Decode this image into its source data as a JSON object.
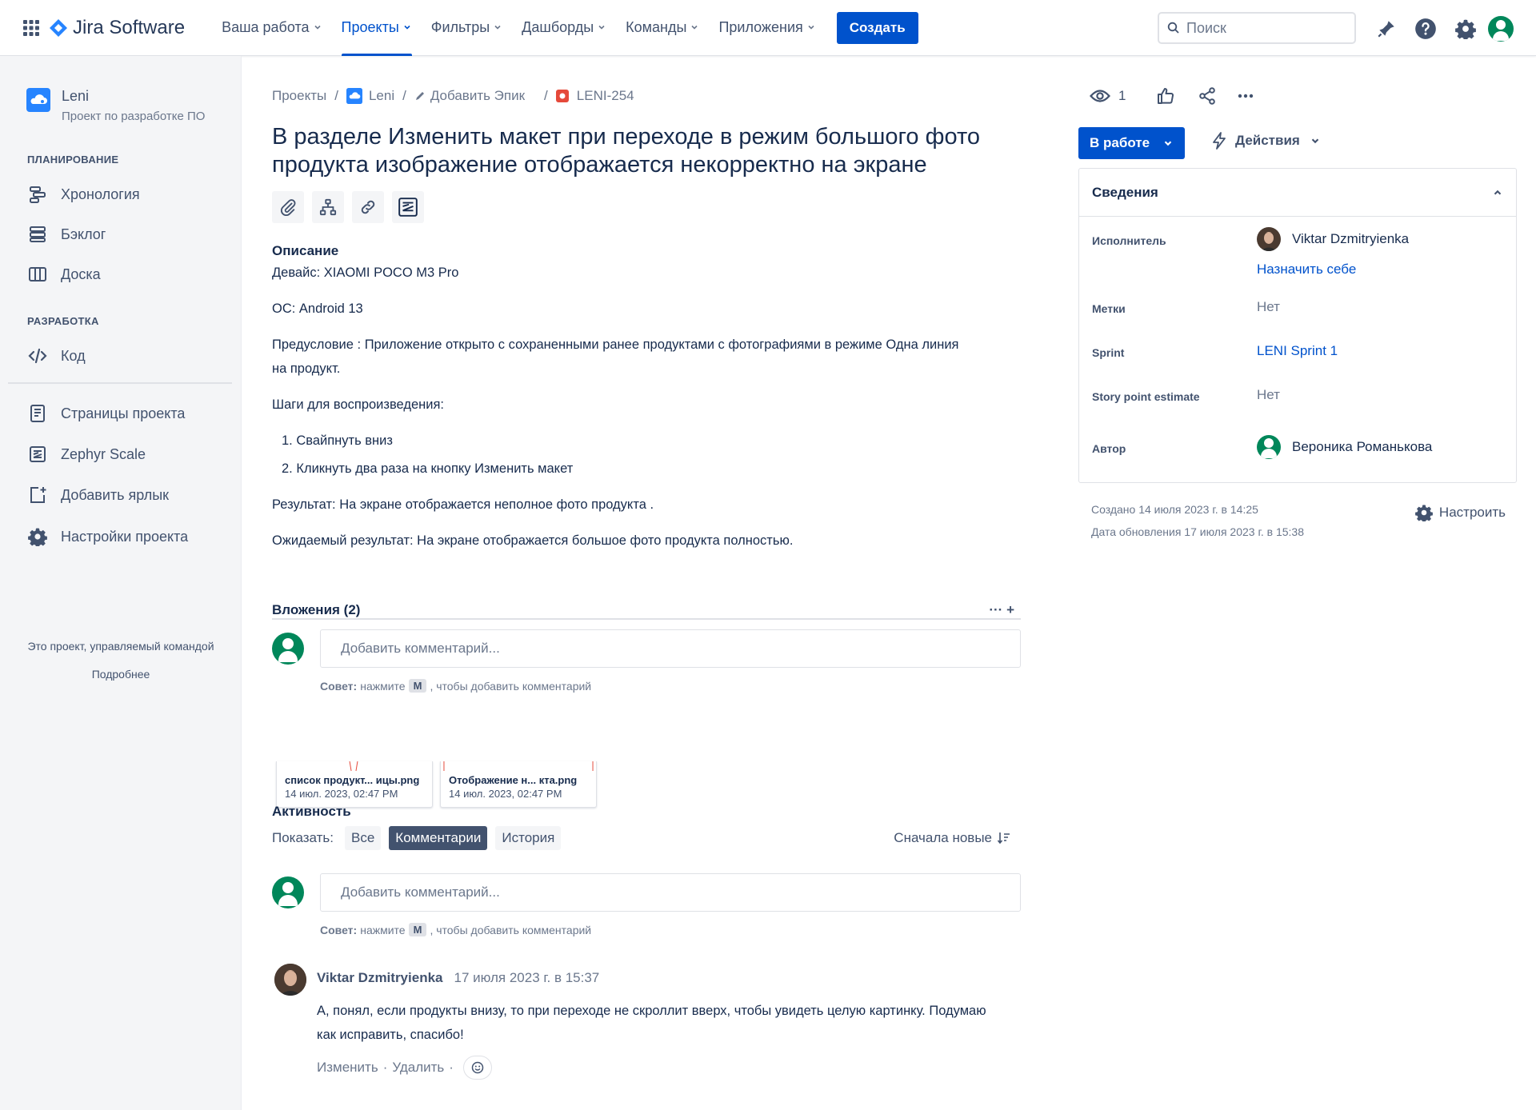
{
  "app": {
    "name": "Jira Software"
  },
  "topnav": {
    "items": [
      {
        "label": "Ваша работа"
      },
      {
        "label": "Проекты"
      },
      {
        "label": "Фильтры"
      },
      {
        "label": "Дашборды"
      },
      {
        "label": "Команды"
      },
      {
        "label": "Приложения"
      }
    ],
    "create_label": "Создать",
    "search_placeholder": "Поиск"
  },
  "sidebar": {
    "project_name": "Leni",
    "project_type": "Проект по разработке ПО",
    "planning_title": "ПЛАНИРОВАНИЕ",
    "planning_items": [
      {
        "label": "Хронология",
        "icon": "timeline-icon"
      },
      {
        "label": "Бэклог",
        "icon": "backlog-icon"
      },
      {
        "label": "Доска",
        "icon": "board-icon"
      }
    ],
    "dev_title": "РАЗРАБОТКА",
    "dev_items": [
      {
        "label": "Код",
        "icon": "code-icon"
      }
    ],
    "other_items": [
      {
        "label": "Страницы проекта",
        "icon": "pages-icon"
      },
      {
        "label": "Zephyr Scale",
        "icon": "zephyr-icon"
      },
      {
        "label": "Добавить ярлык",
        "icon": "add-shortcut-icon"
      },
      {
        "label": "Настройки проекта",
        "icon": "settings-icon"
      }
    ],
    "footer_text": "Это проект, управляемый командой",
    "footer_link": "Подробнее"
  },
  "breadcrumbs": {
    "projects": "Проекты",
    "project": "Leni",
    "epic": "Добавить Эпик",
    "issue_key": "LENI-254"
  },
  "issue": {
    "title": "В разделе Изменить макет при переходе в режим большого фото продукта изображение отображается некорректно на экране",
    "description_label": "Описание",
    "description": {
      "device": "Девайс: XIAOMI POCO M3 Pro",
      "os": "ОС: Android 13",
      "precondition_1": "Предусловие : Приложение открыто с сохраненными ранее продуктами с фотографиями в режиме Одна линия",
      "precondition_2": "на продукт.",
      "steps_label": "Шаги для воспроизведения:",
      "step_1": "1. Свайпнуть вниз",
      "step_2": "2. Кликнуть два раза на кнопку Изменить макет",
      "result": "Результат: На экране отображается неполное  фото продукта .",
      "expected": "Ожидаемый результат: На экране отображается большое фото продукта полностью."
    },
    "attachments_label": "Вложения (2)",
    "attachments_actions": "···  +",
    "attachments": [
      {
        "name": "список продукт... ицы.png",
        "date": "14 июл. 2023, 02:47 PM"
      },
      {
        "name": "Отображение н... кта.png",
        "date": "14 июл. 2023, 02:47 PM"
      }
    ]
  },
  "comment_box": {
    "placeholder": "Добавить комментарий...",
    "tip_bold": "Совет:",
    "tip_press": "нажмите",
    "tip_key": "M",
    "tip_rest": ", чтобы добавить комментарий"
  },
  "activity": {
    "title": "Активность",
    "show_label": "Показать:",
    "filters": [
      {
        "label": "Все"
      },
      {
        "label": "Комментарии"
      },
      {
        "label": "История"
      }
    ],
    "sort_label": "Сначала новые"
  },
  "comments": [
    {
      "author": "Viktar Dzmitryienka",
      "time": "17 июля 2023 г. в 15:37",
      "line_1": "А, понял, если продукты внизу, то при переходе не скроллит вверх, чтобы увидеть целую картинку. Подумаю",
      "line_2": "как исправить, спасибо!",
      "edit_label": "Изменить",
      "delete_label": "Удалить",
      "separator": "·"
    }
  ],
  "right_panel": {
    "watchers_count": "1",
    "status_label": "В работе",
    "actions_label": "Действия",
    "details_title": "Сведения",
    "fields": {
      "assignee_label": "Исполнитель",
      "assignee_value": "Viktar Dzmitryienka",
      "assign_self": "Назначить себе",
      "labels_label": "Метки",
      "labels_value": "Нет",
      "sprint_label": "Sprint",
      "sprint_value": "LENI Sprint 1",
      "sp_label": "Story point estimate",
      "sp_value": "Нет",
      "reporter_label": "Автор",
      "reporter_value": "Вероника Романькова"
    },
    "created": "Создано 14 июля 2023 г. в 14:25",
    "updated": "Дата обновления 17 июля 2023 г. в 15:38",
    "configure_label": "Настроить"
  },
  "colors": {
    "primary": "#0052cc",
    "text": "#172b4d",
    "subtle": "#42526e",
    "muted": "#6b778c",
    "sidebar_bg": "#f4f5f7",
    "avatar_green": "#00875a",
    "epic_red": "#e5493a"
  }
}
